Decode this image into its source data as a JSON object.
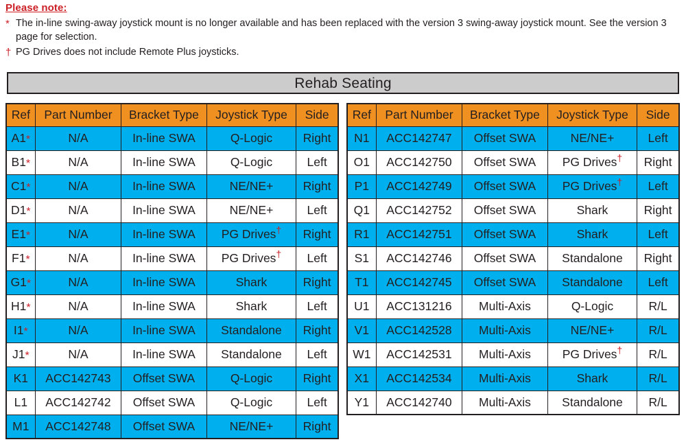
{
  "notes": {
    "heading": "Please note:",
    "items": [
      {
        "marker": "*",
        "marker_name": "asterisk-marker",
        "text": "The in-line swing-away joystick mount is no longer available and has been replaced with the version 3 swing-away joystick mount. See the version 3 page for selection."
      },
      {
        "marker": "†",
        "marker_name": "dagger-marker",
        "text": "PG Drives does not include Remote Plus joysticks."
      }
    ]
  },
  "title": "Rehab Seating",
  "colors": {
    "header_orange": "#f09020",
    "row_highlight_cyan": "#00b0ee",
    "title_gray": "#cccccc",
    "accent_red": "#cc2027",
    "border_black": "#231f20"
  },
  "columns": [
    "Ref",
    "Part Number",
    "Bracket Type",
    "Joystick Type",
    "Side"
  ],
  "tables": [
    {
      "name": "left",
      "rows": [
        {
          "ref": "A1",
          "ref_mark": "*",
          "part": "N/A",
          "bracket": "In-line SWA",
          "joystick": "Q-Logic",
          "joystick_mark": "",
          "side": "Right"
        },
        {
          "ref": "B1",
          "ref_mark": "*",
          "part": "N/A",
          "bracket": "In-line SWA",
          "joystick": "Q-Logic",
          "joystick_mark": "",
          "side": "Left"
        },
        {
          "ref": "C1",
          "ref_mark": "*",
          "part": "N/A",
          "bracket": "In-line SWA",
          "joystick": "NE/NE+",
          "joystick_mark": "",
          "side": "Right"
        },
        {
          "ref": "D1",
          "ref_mark": "*",
          "part": "N/A",
          "bracket": "In-line SWA",
          "joystick": "NE/NE+",
          "joystick_mark": "",
          "side": "Left"
        },
        {
          "ref": "E1",
          "ref_mark": "*",
          "part": "N/A",
          "bracket": "In-line SWA",
          "joystick": "PG Drives",
          "joystick_mark": "†",
          "side": "Right"
        },
        {
          "ref": "F1",
          "ref_mark": "*",
          "part": "N/A",
          "bracket": "In-line SWA",
          "joystick": "PG Drives",
          "joystick_mark": "†",
          "side": "Left"
        },
        {
          "ref": "G1",
          "ref_mark": "*",
          "part": "N/A",
          "bracket": "In-line SWA",
          "joystick": "Shark",
          "joystick_mark": "",
          "side": "Right"
        },
        {
          "ref": "H1",
          "ref_mark": "*",
          "part": "N/A",
          "bracket": "In-line SWA",
          "joystick": "Shark",
          "joystick_mark": "",
          "side": "Left"
        },
        {
          "ref": "I1",
          "ref_mark": "*",
          "part": "N/A",
          "bracket": "In-line SWA",
          "joystick": "Standalone",
          "joystick_mark": "",
          "side": "Right"
        },
        {
          "ref": "J1",
          "ref_mark": "*",
          "part": "N/A",
          "bracket": "In-line SWA",
          "joystick": "Standalone",
          "joystick_mark": "",
          "side": "Left"
        },
        {
          "ref": "K1",
          "ref_mark": "",
          "part": "ACC142743",
          "bracket": "Offset SWA",
          "joystick": "Q-Logic",
          "joystick_mark": "",
          "side": "Right"
        },
        {
          "ref": "L1",
          "ref_mark": "",
          "part": "ACC142742",
          "bracket": "Offset SWA",
          "joystick": "Q-Logic",
          "joystick_mark": "",
          "side": "Left"
        },
        {
          "ref": "M1",
          "ref_mark": "",
          "part": "ACC142748",
          "bracket": "Offset SWA",
          "joystick": "NE/NE+",
          "joystick_mark": "",
          "side": "Right"
        }
      ]
    },
    {
      "name": "right",
      "rows": [
        {
          "ref": "N1",
          "ref_mark": "",
          "part": "ACC142747",
          "bracket": "Offset SWA",
          "joystick": "NE/NE+",
          "joystick_mark": "",
          "side": "Left"
        },
        {
          "ref": "O1",
          "ref_mark": "",
          "part": "ACC142750",
          "bracket": "Offset SWA",
          "joystick": "PG Drives",
          "joystick_mark": "†",
          "side": "Right"
        },
        {
          "ref": "P1",
          "ref_mark": "",
          "part": "ACC142749",
          "bracket": "Offset SWA",
          "joystick": "PG Drives",
          "joystick_mark": "†",
          "side": "Left"
        },
        {
          "ref": "Q1",
          "ref_mark": "",
          "part": "ACC142752",
          "bracket": "Offset SWA",
          "joystick": "Shark",
          "joystick_mark": "",
          "side": "Right"
        },
        {
          "ref": "R1",
          "ref_mark": "",
          "part": "ACC142751",
          "bracket": "Offset SWA",
          "joystick": "Shark",
          "joystick_mark": "",
          "side": "Left"
        },
        {
          "ref": "S1",
          "ref_mark": "",
          "part": "ACC142746",
          "bracket": "Offset SWA",
          "joystick": "Standalone",
          "joystick_mark": "",
          "side": "Right"
        },
        {
          "ref": "T1",
          "ref_mark": "",
          "part": "ACC142745",
          "bracket": "Offset SWA",
          "joystick": "Standalone",
          "joystick_mark": "",
          "side": "Left"
        },
        {
          "ref": "U1",
          "ref_mark": "",
          "part": "ACC131216",
          "bracket": "Multi-Axis",
          "joystick": "Q-Logic",
          "joystick_mark": "",
          "side": "R/L"
        },
        {
          "ref": "V1",
          "ref_mark": "",
          "part": "ACC142528",
          "bracket": "Multi-Axis",
          "joystick": "NE/NE+",
          "joystick_mark": "",
          "side": "R/L"
        },
        {
          "ref": "W1",
          "ref_mark": "",
          "part": "ACC142531",
          "bracket": "Multi-Axis",
          "joystick": "PG Drives",
          "joystick_mark": "†",
          "side": "R/L"
        },
        {
          "ref": "X1",
          "ref_mark": "",
          "part": "ACC142534",
          "bracket": "Multi-Axis",
          "joystick": "Shark",
          "joystick_mark": "",
          "side": "R/L"
        },
        {
          "ref": "Y1",
          "ref_mark": "",
          "part": "ACC142740",
          "bracket": "Multi-Axis",
          "joystick": "Standalone",
          "joystick_mark": "",
          "side": "R/L"
        }
      ]
    }
  ]
}
